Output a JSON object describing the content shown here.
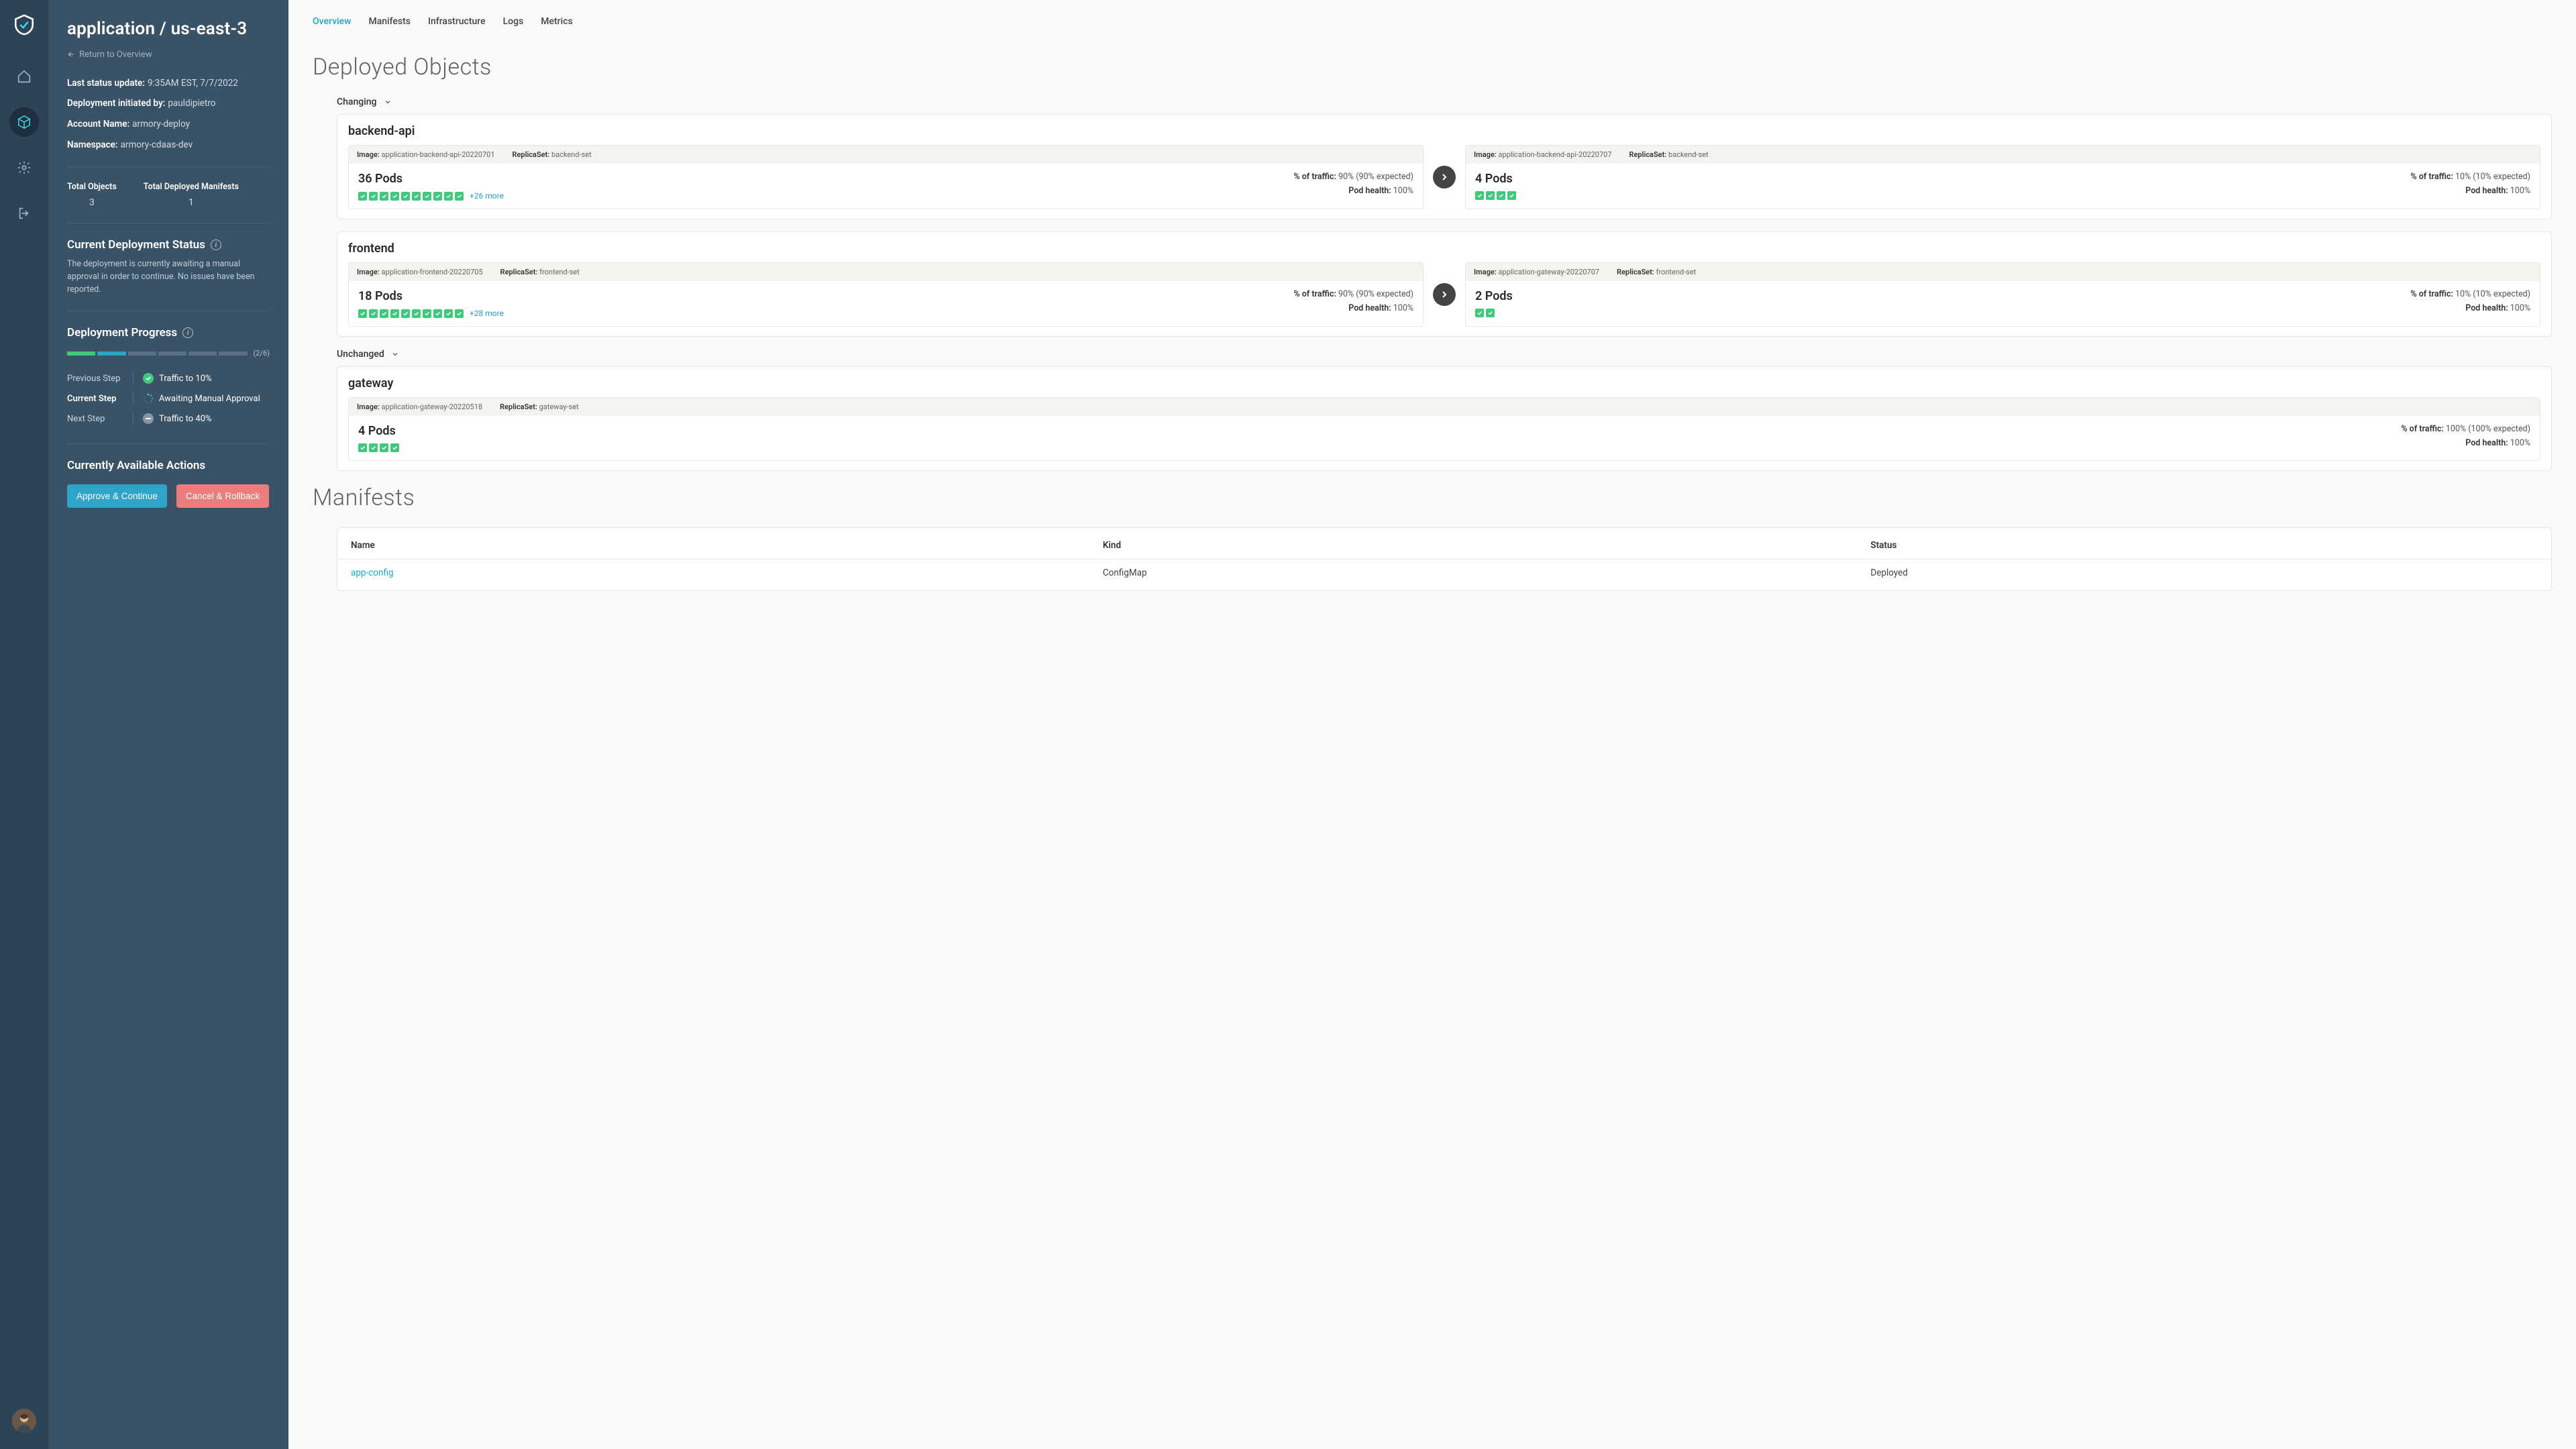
{
  "page_title": "application / us-east-3",
  "return_label": "Return to Overview",
  "meta": {
    "last_update": {
      "label": "Last status update:",
      "value": "9:35AM EST, 7/7/2022"
    },
    "initiated_by": {
      "label": "Deployment initiated by:",
      "value": "pauldipietro"
    },
    "account": {
      "label": "Account Name:",
      "value": "armory-deploy"
    },
    "namespace": {
      "label": "Namespace:",
      "value": "armory-cdaas-dev"
    }
  },
  "totals": {
    "objects": {
      "label": "Total Objects",
      "value": "3"
    },
    "manifests": {
      "label": "Total Deployed Manifests",
      "value": "1"
    }
  },
  "status": {
    "title": "Current Deployment Status",
    "desc": "The deployment is currently awaiting a manual approval in order to continue. No issues have been reported."
  },
  "progress": {
    "title": "Deployment Progress",
    "count": "(2/6)",
    "prev": {
      "label": "Previous Step",
      "value": "Traffic to 10%"
    },
    "current": {
      "label": "Current Step",
      "value": "Awaiting Manual Approval"
    },
    "next": {
      "label": "Next Step",
      "value": "Traffic to 40%"
    }
  },
  "actions": {
    "title": "Currently Available Actions",
    "approve": "Approve & Continue",
    "cancel": "Cancel & Rollback"
  },
  "tabs": [
    "Overview",
    "Manifests",
    "Infrastructure",
    "Logs",
    "Metrics"
  ],
  "deployed_objects": {
    "title": "Deployed Objects",
    "changing_label": "Changing",
    "unchanged_label": "Unchanged",
    "backend": {
      "name": "backend-api",
      "left": {
        "image": "application-backend-api-20220701",
        "replicaset": "backend-set",
        "pods": "36 Pods",
        "more": "+26 more",
        "traffic": "90% (90% expected)",
        "health": "100%"
      },
      "right": {
        "image": "application-backend-api-20220707",
        "replicaset": "backend-set",
        "pods": "4 Pods",
        "traffic": "10% (10% expected)",
        "health": "100%"
      }
    },
    "frontend": {
      "name": "frontend",
      "left": {
        "image": "application-frontend-20220705",
        "replicaset": "frontend-set",
        "pods": "18 Pods",
        "more": "+28 more",
        "traffic": "90% (90% expected)",
        "health": "100%"
      },
      "right": {
        "image": "application-gateway-20220707",
        "replicaset": "frontend-set",
        "pods": "2 Pods",
        "traffic": "10% (10% expected)",
        "health": "100%"
      }
    },
    "gateway": {
      "name": "gateway",
      "image": "application-gateway-20220518",
      "replicaset": "gateway-set",
      "pods": "4 Pods",
      "traffic": "100% (100% expected)",
      "health": "100%"
    }
  },
  "labels": {
    "image": "Image:",
    "replicaset": "ReplicaSet:",
    "traffic": "% of traffic:",
    "health": "Pod health:"
  },
  "manifests": {
    "title": "Manifests",
    "headers": {
      "name": "Name",
      "kind": "Kind",
      "status": "Status"
    },
    "row": {
      "name": "app-config",
      "kind": "ConfigMap",
      "status": "Deployed"
    }
  }
}
